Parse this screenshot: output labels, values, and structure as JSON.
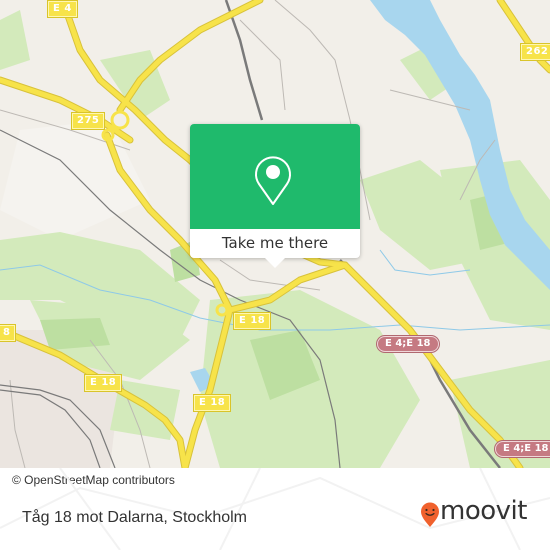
{
  "map": {
    "attribution": "© OpenStreetMap contributors",
    "colors": {
      "land": "#f2efe9",
      "water": "#a8d6ee",
      "forest": "#cfe8b5",
      "forest_dark": "#b7dc9c",
      "motorway": "#f7e34a",
      "motorway_casing": "#e1c93a",
      "rail": "#777777",
      "minor_road": "#bbbbbb",
      "stream": "#8ec9e8",
      "urban": "#e8e3de"
    },
    "road_shields": [
      {
        "id": "e4-top",
        "label": "E 4",
        "type": "national"
      },
      {
        "id": "r275",
        "label": "275",
        "type": "national"
      },
      {
        "id": "r262",
        "label": "262",
        "type": "national"
      },
      {
        "id": "e18-center",
        "label": "E 18",
        "type": "national"
      },
      {
        "id": "e18-left-edge",
        "label": "8",
        "type": "national"
      },
      {
        "id": "e18-left",
        "label": "E 18",
        "type": "national"
      },
      {
        "id": "e18-lower",
        "label": "E 18",
        "type": "national"
      },
      {
        "id": "e4e18-mid",
        "label": "E 4;E 18",
        "type": "european"
      },
      {
        "id": "e4e18-right",
        "label": "E 4;E 18",
        "type": "european"
      }
    ]
  },
  "popup": {
    "icon": "location-pin-icon",
    "button_label": "Take me there",
    "accent": "#1fba6c"
  },
  "footer": {
    "place_name": "Tåg 18 mot Dalarna, Stockholm",
    "brand": "moovit",
    "brand_icon": "moovit-smiley-pin-icon",
    "brand_color": "#f0612d"
  }
}
